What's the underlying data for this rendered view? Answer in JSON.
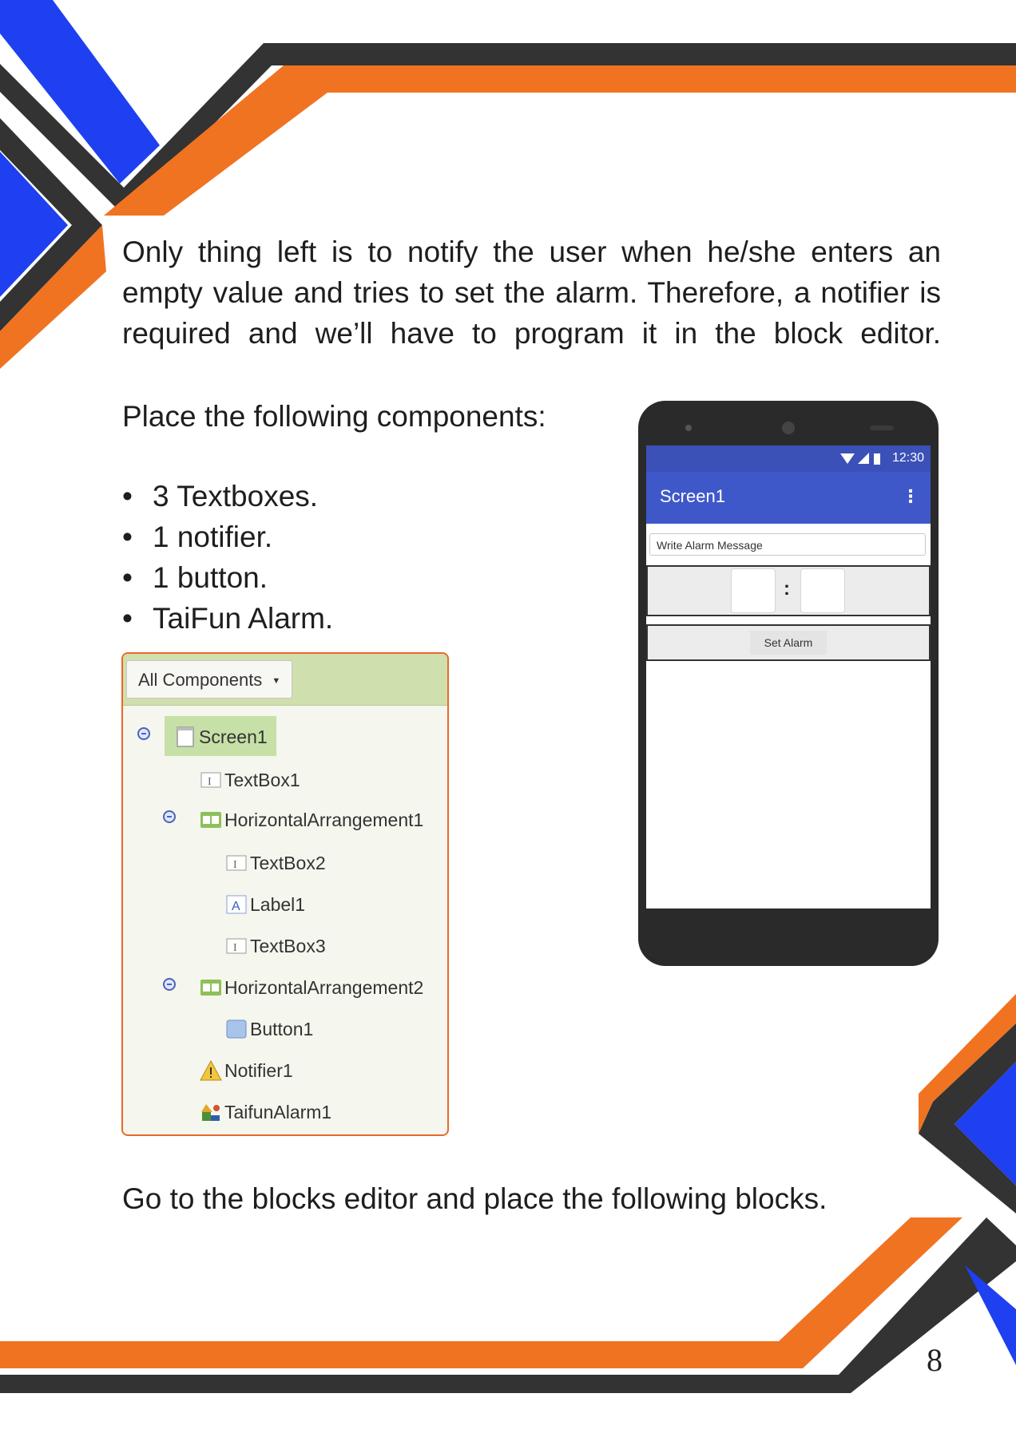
{
  "paragraphs": {
    "intro": "Only thing left is to notify the user when he/she enters an empty value and tries to set the alarm. Therefore, a notifier is required and we’ll have to program it in the block editor.",
    "place": "Place the following components:",
    "blocks": "Go to the blocks editor and place the following blocks."
  },
  "components_list": [
    "3 Textboxes.",
    "1 notifier.",
    "1 button.",
    "TaiFun Alarm."
  ],
  "tree": {
    "dropdown_label": "All Components",
    "nodes": {
      "screen": "Screen1",
      "textbox1": "TextBox1",
      "harr1": "HorizontalArrangement1",
      "textbox2": "TextBox2",
      "label1": "Label1",
      "textbox3": "TextBox3",
      "harr2": "HorizontalArrangement2",
      "button1": "Button1",
      "notifier1": "Notifier1",
      "alarm1": "TaifunAlarm1"
    }
  },
  "phone": {
    "time": "12:30",
    "title": "Screen1",
    "message_placeholder": "Write Alarm Message",
    "colon": ":",
    "button_label": "Set Alarm"
  },
  "page_number": "8",
  "colors": {
    "orange": "#f07322",
    "blue": "#1e40f0",
    "dark": "#333333"
  }
}
